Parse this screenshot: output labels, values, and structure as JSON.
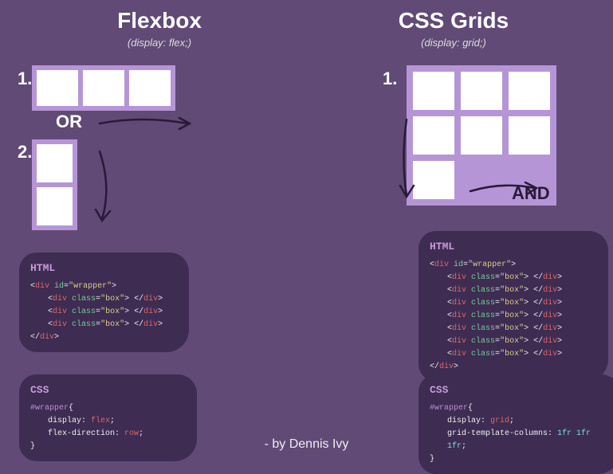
{
  "flexbox": {
    "title": "Flexbox",
    "subtitle": "(display: flex;)",
    "num1": "1.",
    "or": "OR",
    "num2": "2.",
    "html_ttl": "HTML",
    "css_ttl": "CSS",
    "wrapper_open_a": "<div ",
    "id_kw": "id",
    "eq": "=",
    "q": "\"",
    "wrapper_id": "wrapper",
    "close_tag": ">",
    "box_open": "<div ",
    "class_kw": "class",
    "box_cls": "box",
    "box_close": "> </",
    "div_end": "div>",
    "wrapper_close": "</div>",
    "sel": "#wrapper",
    "brace_o": "{",
    "brace_c": "}",
    "p1k": "display",
    "p1v": "flex",
    "semi": ";",
    "p2k": "flex-direction",
    "p2v": "row"
  },
  "grids": {
    "title": "CSS Grids",
    "subtitle": "(display: grid;)",
    "num1": "1.",
    "and": "AND",
    "html_ttl": "HTML",
    "css_ttl": "CSS",
    "sel": "#wrapper",
    "brace_o": "{",
    "brace_c": "}",
    "p1k": "display",
    "p1v": "grid",
    "semi": ";",
    "p2k": "grid-template-columns",
    "p2v": "1fr 1fr 1fr"
  },
  "credit": "- by Dennis Ivy"
}
